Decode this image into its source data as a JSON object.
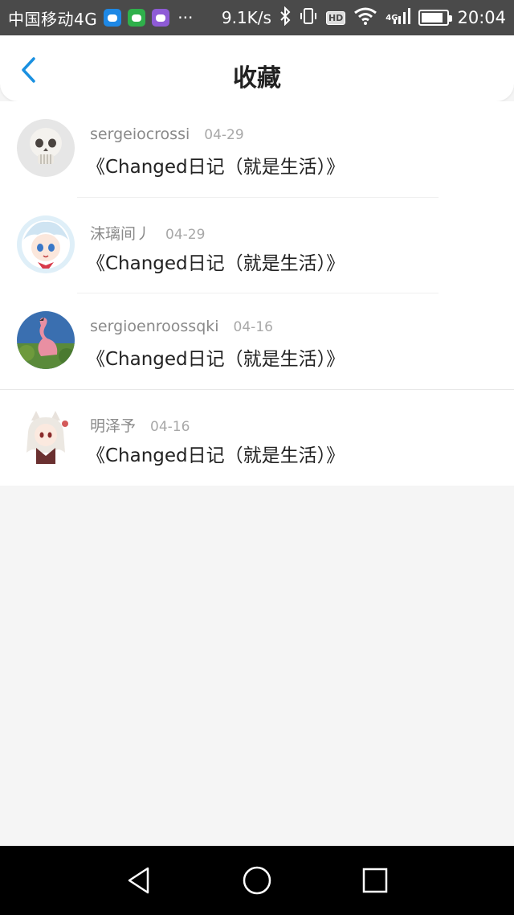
{
  "status_bar": {
    "carrier": "中国移动4G",
    "dots": "···",
    "speed": "9.1K/s",
    "hd": "HD",
    "net": "4G",
    "time": "20:04",
    "battery_level": 0.85
  },
  "header": {
    "title": "收藏",
    "accent_color": "#1a90e0"
  },
  "favorites": [
    {
      "username": "sergeiocrossi",
      "date": "04-29",
      "title": "《Changed日记（就是生活）》",
      "avatar": "skull-avatar"
    },
    {
      "username": "沫璃间丿",
      "date": "04-29",
      "title": "《Changed日记（就是生活）》",
      "avatar": "anime-girl-avatar"
    },
    {
      "username": "sergioenroossqki",
      "date": "04-16",
      "title": "《Changed日记（就是生活）》",
      "avatar": "flamingo-avatar"
    },
    {
      "username": "明泽予",
      "date": "04-16",
      "title": "《Changed日记（就是生活）》",
      "avatar": "anime-catgirl-avatar"
    }
  ],
  "navbar": {
    "back": "back-triangle-icon",
    "home": "home-circle-icon",
    "recent": "recent-square-icon"
  }
}
